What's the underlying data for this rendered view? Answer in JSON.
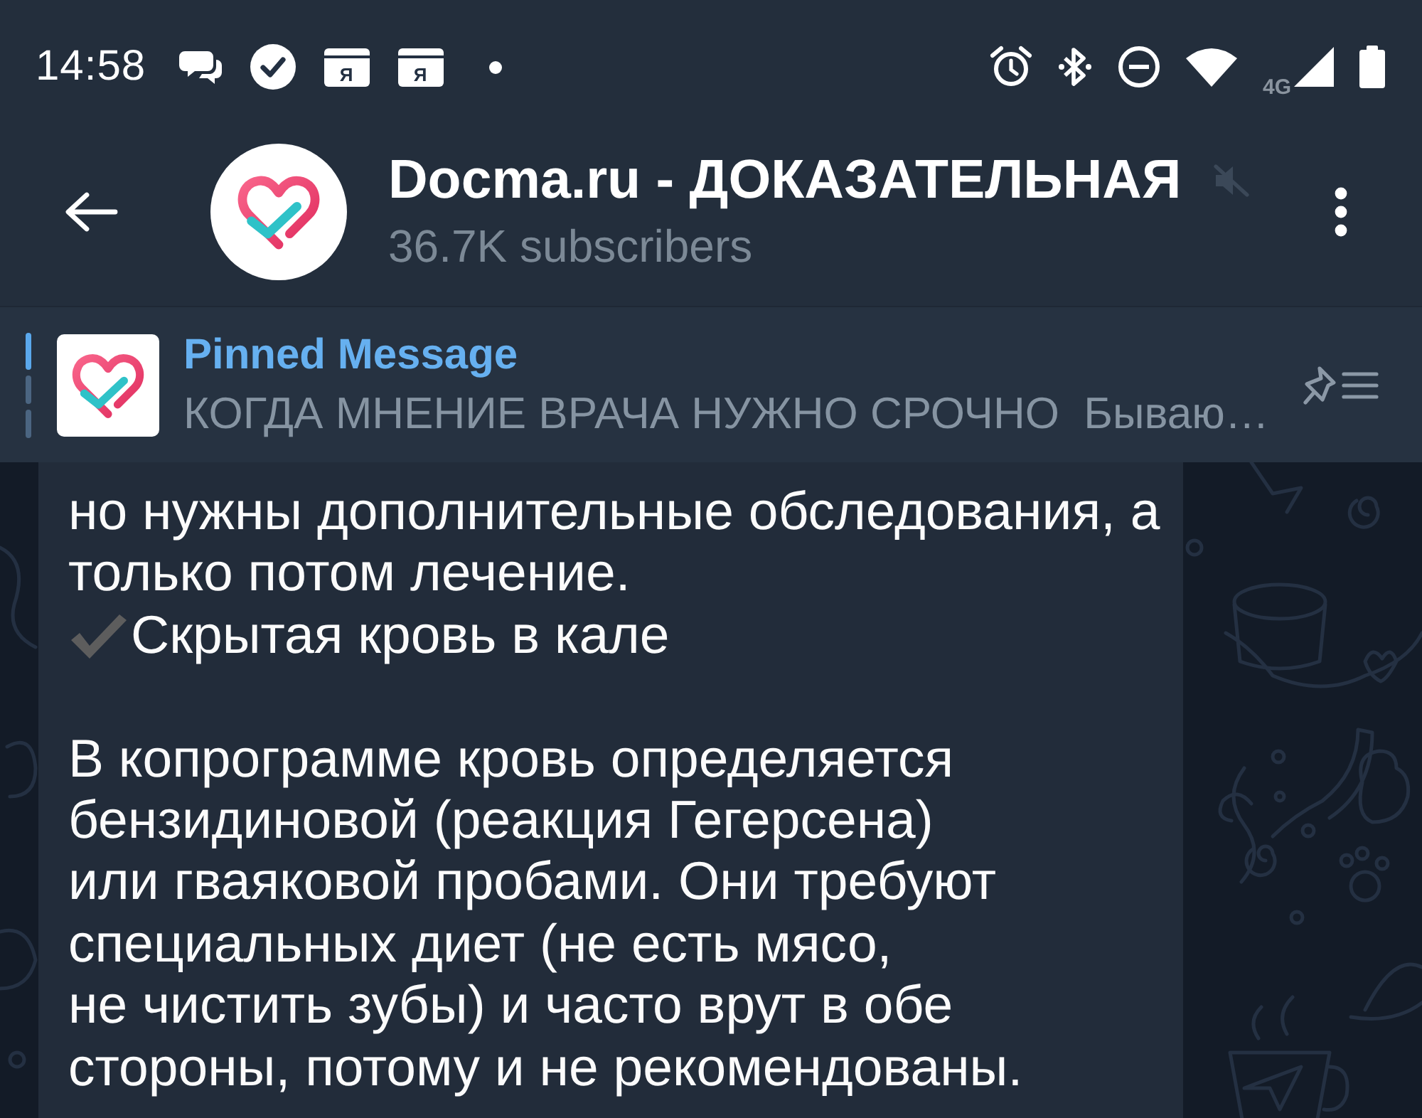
{
  "status_bar": {
    "time": "14:58",
    "notifications": [
      {
        "kind": "chat"
      },
      {
        "kind": "check"
      },
      {
        "kind": "app",
        "label": "Я"
      },
      {
        "kind": "app",
        "label": "Я"
      },
      {
        "kind": "more"
      }
    ],
    "network": "4G"
  },
  "header": {
    "title": "Docma.ru - ДОКАЗАТЕЛЬНАЯ",
    "muted": true,
    "subtitle": "36.7K subscribers"
  },
  "pinned": {
    "title": "Pinned Message",
    "preview": "КОГДА МНЕНИЕ ВРАЧА НУЖНО СРОЧНО  Бываю…",
    "pages": [
      {
        "selected": true
      },
      {
        "selected": false
      },
      {
        "selected": false
      }
    ]
  },
  "message": {
    "blocks": [
      {
        "kind": "text",
        "text": "но нужны дополнительные обследования, а\nтолько потом лечение."
      },
      {
        "kind": "check",
        "text": "Скрытая кровь в кале"
      },
      {
        "kind": "text",
        "text": "В копрограмме кровь определяется\nбензидиновой (реакция Гегерсена)\nили гваяковой пробами. Они требуют\nспециальных диет (не есть мясо,\nне чистить зубы) и часто врут в обе\nстороны, потому и не рекомендованы."
      }
    ]
  }
}
